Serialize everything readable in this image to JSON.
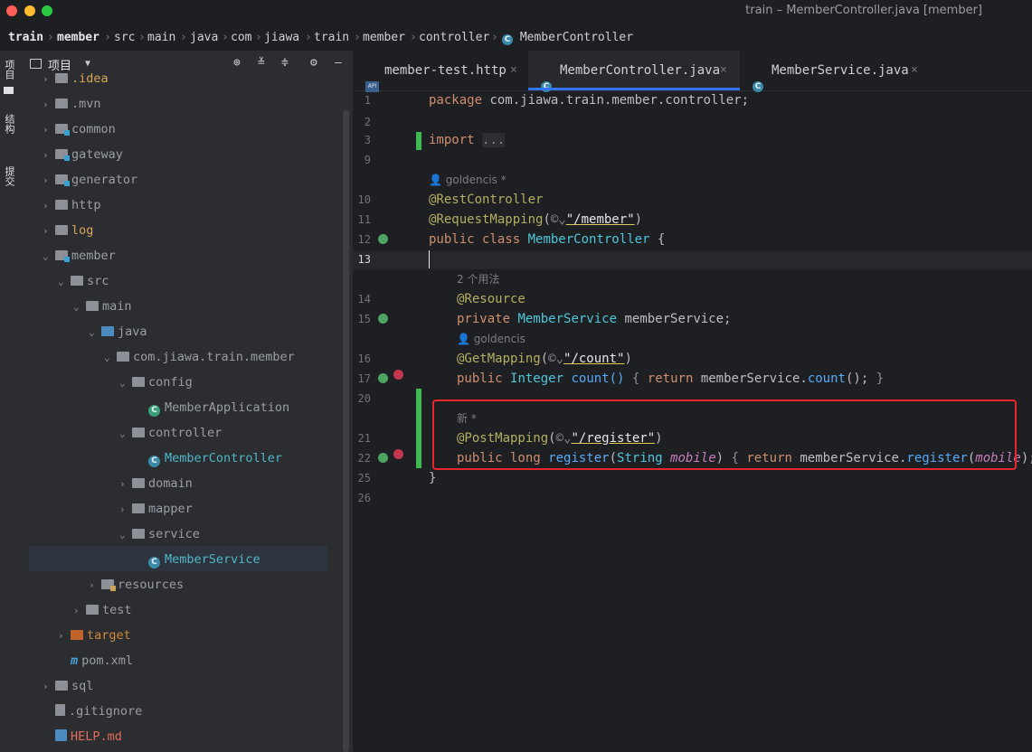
{
  "window": {
    "title": "train – MemberController.java [member]"
  },
  "breadcrumb": [
    "train",
    "member",
    "src",
    "main",
    "java",
    "com",
    "jiawa",
    "train",
    "member",
    "controller",
    "MemberController"
  ],
  "left_strip": {
    "project_label": "项目",
    "structure_label": "结构",
    "commit_label": "提交"
  },
  "project_panel": {
    "title": "项目",
    "items": [
      {
        "label": ".idea",
        "color": "yellow"
      },
      {
        "label": ".mvn"
      },
      {
        "label": "common"
      },
      {
        "label": "gateway"
      },
      {
        "label": "generator"
      },
      {
        "label": "http"
      },
      {
        "label": "log"
      },
      {
        "label": "member"
      },
      {
        "label": "src"
      },
      {
        "label": "main"
      },
      {
        "label": "java"
      },
      {
        "label": "com.jiawa.train.member"
      },
      {
        "label": "config"
      },
      {
        "label": "MemberApplication"
      },
      {
        "label": "controller"
      },
      {
        "label": "MemberController"
      },
      {
        "label": "domain"
      },
      {
        "label": "mapper"
      },
      {
        "label": "service"
      },
      {
        "label": "MemberService"
      },
      {
        "label": "resources"
      },
      {
        "label": "test"
      },
      {
        "label": "target"
      },
      {
        "label": "pom.xml"
      },
      {
        "label": "sql"
      },
      {
        "label": ".gitignore"
      },
      {
        "label": "HELP.md"
      }
    ]
  },
  "tabs": [
    {
      "label": "member-test.http",
      "active": false
    },
    {
      "label": "MemberController.java",
      "active": true
    },
    {
      "label": "MemberService.java",
      "active": false
    }
  ],
  "line_numbers": [
    "1",
    "2",
    "3",
    "9",
    "10",
    "11",
    "12",
    "13",
    "14",
    "15",
    "16",
    "17",
    "20",
    "21",
    "22",
    "25",
    "26"
  ],
  "code": {
    "package_kw": "package",
    "package_name": "com.jiawa.train.member.controller;",
    "import_kw": "import",
    "import_fold": "...",
    "author_hint_1": "goldencis *",
    "ann_rest": "@RestController",
    "ann_reqmap": "@RequestMapping",
    "reqmap_path": "\"/member\"",
    "class_decl_kw": "public class",
    "class_name": "MemberController",
    "open_brace": "{",
    "usages_hint": "2 个用法",
    "ann_resource": "@Resource",
    "field_kw": "private",
    "field_type": "MemberService",
    "field_name": "memberService;",
    "author_hint_2": "goldencis",
    "ann_getmap": "@GetMapping",
    "getmap_path": "\"/count\"",
    "count_kw": "public",
    "count_type": "Integer",
    "count_sig": "count()",
    "count_body_return": "return",
    "count_body_call": "memberService.",
    "count_body_method": "count",
    "count_body_end": "();",
    "new_hint": "新 *",
    "ann_postmap": "@PostMapping",
    "postmap_path": "\"/register\"",
    "reg_kw": "public long",
    "reg_name": "register",
    "reg_param_type": "String",
    "reg_param_name": "mobile",
    "reg_return": "return",
    "reg_call": "memberService.",
    "reg_method": "register",
    "reg_arg": "mobile",
    "reg_end": ");",
    "close_brace": "}"
  },
  "colors": {
    "accent": "#3574f0",
    "highlight_box": "#e8262b",
    "change_bar": "#3fb950"
  }
}
